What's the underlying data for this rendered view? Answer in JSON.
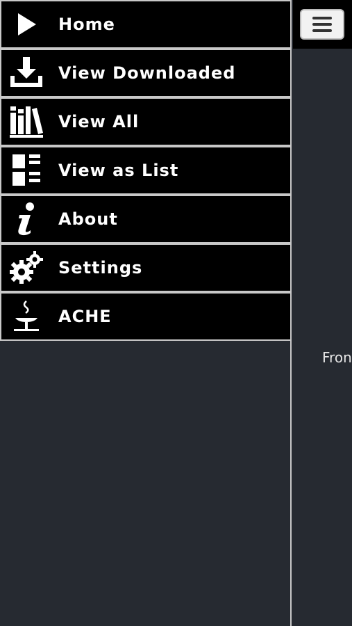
{
  "menu": {
    "items": [
      {
        "label": "Home",
        "icon": "play-icon"
      },
      {
        "label": "View Downloaded",
        "icon": "download-icon"
      },
      {
        "label": "View All",
        "icon": "library-icon"
      },
      {
        "label": "View as List",
        "icon": "list-view-icon"
      },
      {
        "label": "About",
        "icon": "info-icon"
      },
      {
        "label": "Settings",
        "icon": "gear-icon"
      },
      {
        "label": "ACHE",
        "icon": "ache-logo-icon"
      }
    ]
  },
  "main": {
    "menu_button_icon": "hamburger-icon",
    "partial_text": "Fron"
  },
  "colors": {
    "background": "#262a31",
    "menu_item_bg": "#000000",
    "border": "#c8c8c8",
    "text": "#ffffff"
  }
}
